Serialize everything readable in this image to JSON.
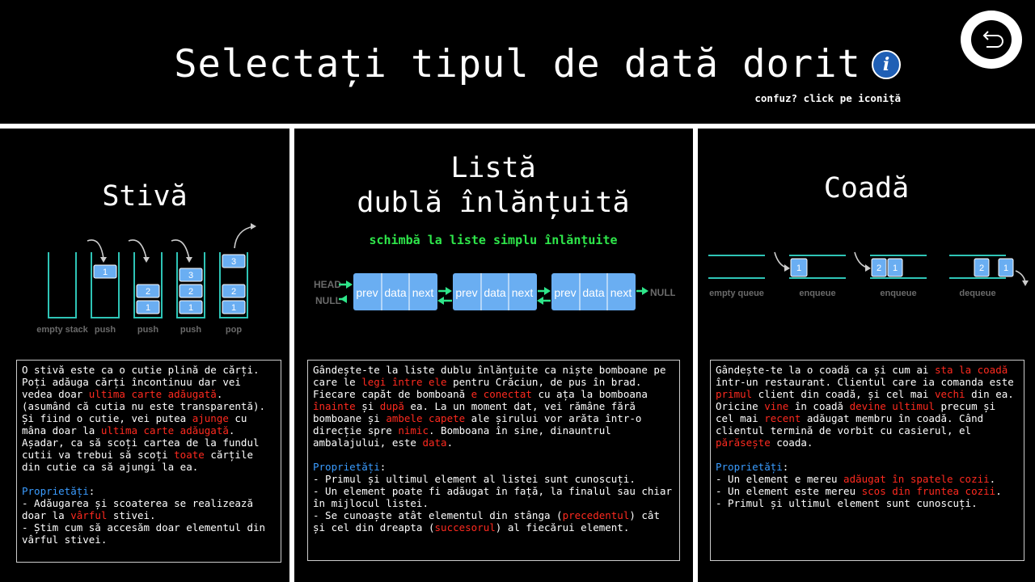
{
  "header": {
    "title": "Selectați tipul de dată dorit",
    "hint": "confuz? click pe iconiță",
    "info_icon": "info-icon",
    "back_icon": "back-arrow-icon"
  },
  "stack": {
    "title": "Stivă",
    "diagram_labels": [
      "empty stack",
      "push",
      "push",
      "push",
      "pop"
    ],
    "description": {
      "p1_a": "O stivă este ca o cutie plină de cărți. Poți adăuga cărți încontinuu dar vei vedea doar ",
      "p1_r1": "ultima carte adăugată",
      "p1_b": ". (asumând că cutia nu este transparentă).\nȘi fiind o cutie, vei putea ",
      "p1_r2": "ajunge",
      "p1_c": " cu mâna doar la ",
      "p1_r3": "ultima carte adăugată",
      "p1_d": ". Așadar, ca să scoți cartea de la fundul cutii va trebui să scoți ",
      "p1_r4": "toate",
      "p1_e": " cărțile din cutie ca să ajungi la ea.",
      "props_label": "Proprietăți",
      "props_colon": ":",
      "prop1_a": "- Adăugarea și scoaterea se realizează doar la ",
      "prop1_r": "vârful",
      "prop1_b": " stivei.",
      "prop2": "- Știm cum să accesăm doar elementul din vârful stivei."
    }
  },
  "list": {
    "title_line1": "Listă",
    "title_line2": "dublă înlănțuită",
    "switch_label": "schimbă la liste simplu înlănțuite",
    "diagram": {
      "head_label": "HEAD",
      "null_left": "NULL",
      "null_right": "NULL",
      "node_fields": [
        "prev",
        "data",
        "next"
      ]
    },
    "description": {
      "p1_a": "Gândește-te la liste dublu înlănțuite ca niște bomboane pe care le ",
      "p1_r1": "legi între ele",
      "p1_b": " pentru Crăciun, de pus în brad. Fiecare capăt de bomboană ",
      "p1_r2": "e conectat",
      "p1_c": " cu ața la bomboana ",
      "p1_r3": "înainte",
      "p1_d": " și ",
      "p1_r4": "după",
      "p1_e": " ea. La un moment dat, vei rămâne fără bomboane și ",
      "p1_r5": "ambele capete",
      "p1_f": " ale șirului vor arăta într-o direcție spre ",
      "p1_r6": "nimic",
      "p1_g": ". Bomboana în sine, dinauntrul ambalajului, este ",
      "p1_r7": "data",
      "p1_h": ".",
      "props_label": "Proprietăți",
      "props_colon": ":",
      "prop1": "- Primul și ultimul element al listei sunt cunoscuți.",
      "prop2": "- Un element poate fi adăugat în față, la finalul sau chiar în mijlocul listei.",
      "prop3_a": "- Se cunoaște atât elementul din stânga (",
      "prop3_r1": "precedentul",
      "prop3_b": ") cât și cel din dreapta (",
      "prop3_r2": "succesorul",
      "prop3_c": ") al fiecărui element."
    }
  },
  "queue": {
    "title": "Coadă",
    "diagram_labels": [
      "empty queue",
      "enqueue",
      "enqueue",
      "dequeue"
    ],
    "description": {
      "p1_a": "Gândește-te la o coadă ca și cum ai ",
      "p1_r1": "sta la coadă",
      "p1_b": " într-un restaurant. Clientul care ia comanda este ",
      "p1_r2": "primul",
      "p1_c": " client din coadă, și cel mai ",
      "p1_r3": "vechi",
      "p1_d": " din ea. Oricine ",
      "p1_r4": "vine",
      "p1_e": " în coadă ",
      "p1_r5": "devine ultimul",
      "p1_f": " precum și cel mai ",
      "p1_r6": "recent",
      "p1_g": " adăugat membru în coadă. Când clientul termină de vorbit cu casierul, el ",
      "p1_r7": "părăsește",
      "p1_h": " coada.",
      "props_label": "Proprietăți",
      "props_colon": ":",
      "prop1_a": "- Un element e mereu ",
      "prop1_r": "adăugat în spatele cozii",
      "prop1_b": ".",
      "prop2_a": "- Un element este mereu ",
      "prop2_r": "scos din fruntea cozii",
      "prop2_b": ".",
      "prop3": "- Primul și ultimul element sunt cunoscuți."
    }
  },
  "colors": {
    "highlight": "#ff2a1f",
    "properties": "#3a9cff",
    "switch_link": "#2ee64a",
    "node_fill": "#6aaef2",
    "teal_outline": "#2ec4b6"
  }
}
